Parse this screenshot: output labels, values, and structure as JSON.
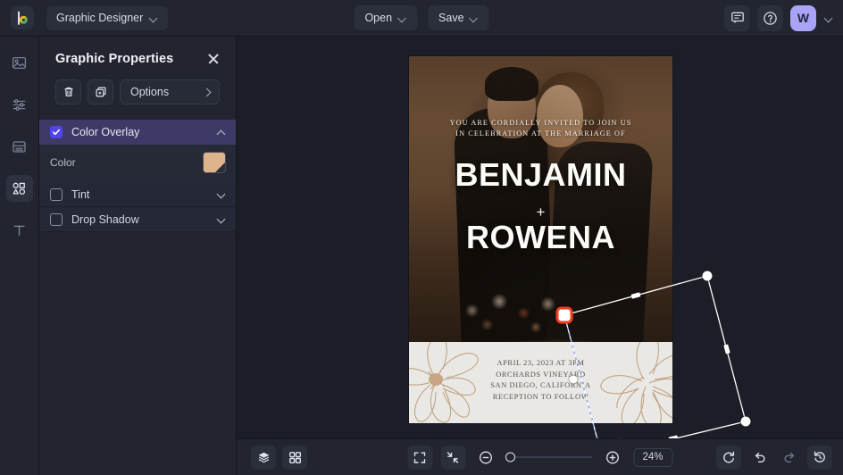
{
  "topbar": {
    "logo": "brand-logo",
    "project_title": "Graphic Designer",
    "open_label": "Open",
    "save_label": "Save",
    "feedback_icon": "chat-icon",
    "help_icon": "help-circle-icon",
    "avatar_initial": "W"
  },
  "rail": {
    "items": [
      {
        "name": "image-tool",
        "icon": "image-icon"
      },
      {
        "name": "adjust-tool",
        "icon": "sliders-icon"
      },
      {
        "name": "layout-tool",
        "icon": "layout-icon"
      },
      {
        "name": "shapes-tool",
        "icon": "shapes-icon",
        "active": true
      },
      {
        "name": "text-tool",
        "icon": "text-icon"
      }
    ]
  },
  "panel": {
    "title": "Graphic Properties",
    "close_icon": "close-icon",
    "delete_icon": "trash-icon",
    "duplicate_icon": "duplicate-icon",
    "options_label": "Options",
    "options_chevron": "chevron-right-icon",
    "sections": [
      {
        "label": "Color Overlay",
        "checked": true,
        "expanded": true,
        "caret": "chevron-up-icon",
        "property_label": "Color",
        "property_value": "#E0B48A"
      },
      {
        "label": "Tint",
        "checked": false,
        "expanded": false,
        "caret": "chevron-down-icon"
      },
      {
        "label": "Drop Shadow",
        "checked": false,
        "expanded": false,
        "caret": "chevron-down-icon"
      }
    ]
  },
  "artwork": {
    "invite_line1": "YOU ARE CORDIALLY INVITED TO JOIN US",
    "invite_line2": "IN CELEBRATION AT THE MARRIAGE OF",
    "name1": "BENJAMIN",
    "plus": "+",
    "name2": "ROWENA",
    "details": [
      "APRIL 23, 2023 AT 3PM",
      "ORCHARDS VINEYARD",
      "SAN DIEGO, CALIFORNIA",
      "RECEPTION TO FOLLOW"
    ]
  },
  "bottombar": {
    "layers_icon": "layers-icon",
    "grid_icon": "grid-icon",
    "fit_icon": "fit-screen-icon",
    "collapse_icon": "shrink-icon",
    "zoom_out_icon": "zoom-out-icon",
    "zoom_in_icon": "zoom-in-icon",
    "zoom_value": "24%",
    "reset_icon": "reset-icon",
    "undo_icon": "undo-icon",
    "redo_icon": "redo-icon",
    "history_icon": "history-icon"
  },
  "colors": {
    "accent": "#4F46E5",
    "section_active": "#3D3A67",
    "avatar_bg": "#A9A4F5",
    "handle_active": "#F03E1E",
    "swatch": "#E0B48A"
  }
}
